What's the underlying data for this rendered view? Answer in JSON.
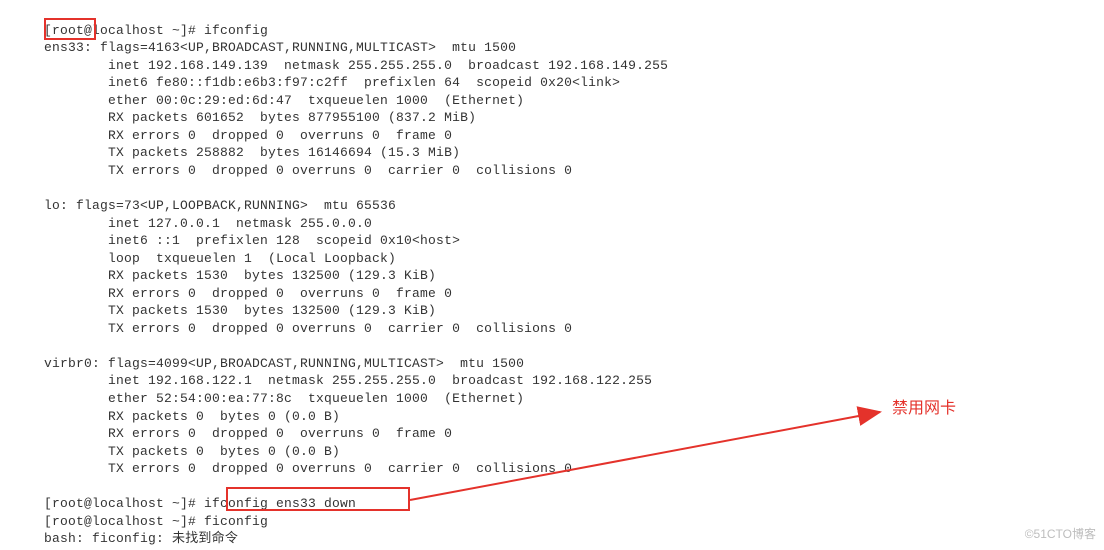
{
  "prompt1": "[root@localhost ~]# ",
  "cmd1": "ifconfig",
  "ens33": {
    "name": "ens33:",
    "flags": " flags=4163<UP,BROADCAST,RUNNING,MULTICAST>  mtu 1500",
    "inet": "        inet 192.168.149.139  netmask 255.255.255.0  broadcast 192.168.149.255",
    "inet6": "        inet6 fe80::f1db:e6b3:f97:c2ff  prefixlen 64  scopeid 0x20<link>",
    "ether": "        ether 00:0c:29:ed:6d:47  txqueuelen 1000  (Ethernet)",
    "rxp": "        RX packets 601652  bytes 877955100 (837.2 MiB)",
    "rxe": "        RX errors 0  dropped 0  overruns 0  frame 0",
    "txp": "        TX packets 258882  bytes 16146694 (15.3 MiB)",
    "txe": "        TX errors 0  dropped 0 overruns 0  carrier 0  collisions 0"
  },
  "lo": {
    "head": "lo: flags=73<UP,LOOPBACK,RUNNING>  mtu 65536",
    "inet": "        inet 127.0.0.1  netmask 255.0.0.0",
    "inet6": "        inet6 ::1  prefixlen 128  scopeid 0x10<host>",
    "loop": "        loop  txqueuelen 1  (Local Loopback)",
    "rxp": "        RX packets 1530  bytes 132500 (129.3 KiB)",
    "rxe": "        RX errors 0  dropped 0  overruns 0  frame 0",
    "txp": "        TX packets 1530  bytes 132500 (129.3 KiB)",
    "txe": "        TX errors 0  dropped 0 overruns 0  carrier 0  collisions 0"
  },
  "virbr0": {
    "head": "virbr0: flags=4099<UP,BROADCAST,RUNNING,MULTICAST>  mtu 1500",
    "inet": "        inet 192.168.122.1  netmask 255.255.255.0  broadcast 192.168.122.255",
    "ether": "        ether 52:54:00:ea:77:8c  txqueuelen 1000  (Ethernet)",
    "rxp": "        RX packets 0  bytes 0 (0.0 B)",
    "rxe": "        RX errors 0  dropped 0  overruns 0  frame 0",
    "txp": "        TX packets 0  bytes 0 (0.0 B)",
    "txe": "        TX errors 0  dropped 0 overruns 0  carrier 0  collisions 0"
  },
  "prompt2": "[root@localhost ~]# ",
  "cmd2": "ifconfig ens33 down",
  "prompt3": "[root@localhost ~]# ",
  "cmd3": "ficonfig",
  "err": "bash: ficonfig: 未找到命令",
  "annotation": "禁用网卡",
  "watermark": "©51CTO博客"
}
